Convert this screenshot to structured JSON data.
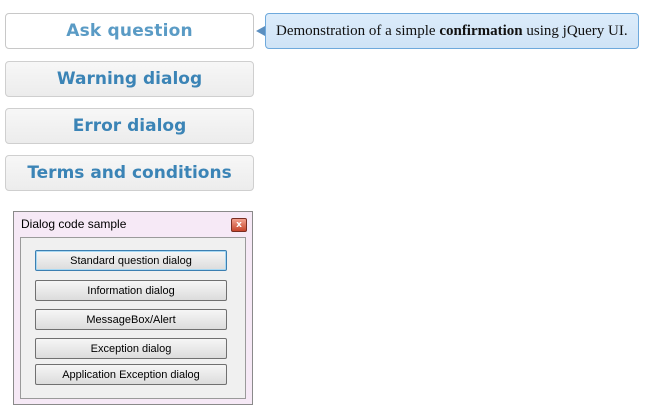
{
  "menu": {
    "items": [
      {
        "label": "Ask question"
      },
      {
        "label": "Warning dialog"
      },
      {
        "label": "Error dialog"
      },
      {
        "label": "Terms and conditions"
      }
    ]
  },
  "tooltip": {
    "text_before": "Demonstration of a simple ",
    "text_bold": "confirmation",
    "text_after": " using jQuery UI."
  },
  "dialog": {
    "title": "Dialog code sample",
    "close_glyph": "x",
    "buttons": [
      {
        "label": "Standard question dialog"
      },
      {
        "label": "Information dialog"
      },
      {
        "label": "MessageBox/Alert"
      },
      {
        "label": "Exception dialog"
      },
      {
        "label": "Application Exception dialog"
      }
    ]
  },
  "colors": {
    "accent_text": "#3b84b6",
    "tooltip_border": "#6ea9dc",
    "tooltip_bg": "#d6e9fa",
    "window_frame": "#f6e9f6",
    "close_button": "#c7452c"
  }
}
